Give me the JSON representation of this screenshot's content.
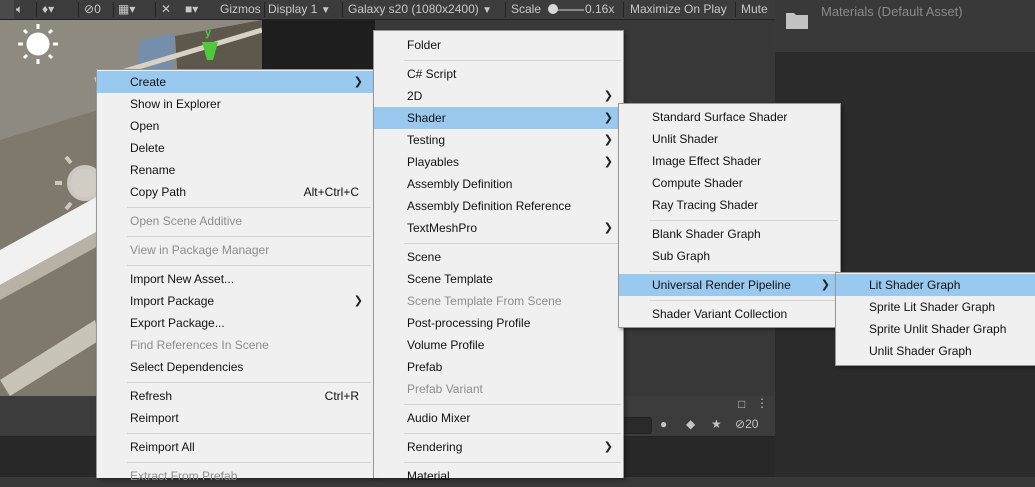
{
  "toolbar": {
    "hidden_count": "0",
    "gizmos": "Gizmos",
    "display": "Display 1",
    "device": "Galaxy s20 (1080x2400)",
    "scale_label": "Scale",
    "scale_value": "0.16x",
    "maximize": "Maximize On Play",
    "mute": "Mute"
  },
  "project": {
    "asset_label": "Materials (Default Asset)"
  },
  "console": {
    "visibility_count": "20"
  },
  "menu1": {
    "items": [
      {
        "label": "Create",
        "shortcut": ""
      },
      {
        "label": "Show in Explorer",
        "shortcut": ""
      },
      {
        "label": "Open",
        "shortcut": ""
      },
      {
        "label": "Delete",
        "shortcut": ""
      },
      {
        "label": "Rename",
        "shortcut": ""
      },
      {
        "label": "Copy Path",
        "shortcut": "Alt+Ctrl+C"
      },
      {
        "label": "Open Scene Additive",
        "shortcut": ""
      },
      {
        "label": "View in Package Manager",
        "shortcut": ""
      },
      {
        "label": "Import New Asset...",
        "shortcut": ""
      },
      {
        "label": "Import Package",
        "shortcut": ""
      },
      {
        "label": "Export Package...",
        "shortcut": ""
      },
      {
        "label": "Find References In Scene",
        "shortcut": ""
      },
      {
        "label": "Select Dependencies",
        "shortcut": ""
      },
      {
        "label": "Refresh",
        "shortcut": "Ctrl+R"
      },
      {
        "label": "Reimport",
        "shortcut": ""
      },
      {
        "label": "Reimport All",
        "shortcut": ""
      },
      {
        "label": "Extract From Prefab",
        "shortcut": ""
      }
    ]
  },
  "menu2": {
    "items": [
      {
        "label": "Folder"
      },
      {
        "label": "C# Script"
      },
      {
        "label": "2D"
      },
      {
        "label": "Shader"
      },
      {
        "label": "Testing"
      },
      {
        "label": "Playables"
      },
      {
        "label": "Assembly Definition"
      },
      {
        "label": "Assembly Definition Reference"
      },
      {
        "label": "TextMeshPro"
      },
      {
        "label": "Scene"
      },
      {
        "label": "Scene Template"
      },
      {
        "label": "Scene Template From Scene"
      },
      {
        "label": "Post-processing Profile"
      },
      {
        "label": "Volume Profile"
      },
      {
        "label": "Prefab"
      },
      {
        "label": "Prefab Variant"
      },
      {
        "label": "Audio Mixer"
      },
      {
        "label": "Rendering"
      },
      {
        "label": "Material"
      }
    ]
  },
  "menu3": {
    "items": [
      {
        "label": "Standard Surface Shader"
      },
      {
        "label": "Unlit Shader"
      },
      {
        "label": "Image Effect Shader"
      },
      {
        "label": "Compute Shader"
      },
      {
        "label": "Ray Tracing Shader"
      },
      {
        "label": "Blank Shader Graph"
      },
      {
        "label": "Sub Graph"
      },
      {
        "label": "Universal Render Pipeline"
      },
      {
        "label": "Shader Variant Collection"
      }
    ]
  },
  "menu4": {
    "items": [
      {
        "label": "Lit Shader Graph"
      },
      {
        "label": "Sprite Lit Shader Graph"
      },
      {
        "label": "Sprite Unlit Shader Graph"
      },
      {
        "label": "Unlit Shader Graph"
      }
    ]
  },
  "colors": {
    "highlight": "#99c9ef",
    "menu_bg": "#f0f0f0",
    "disabled": "#8d8d8d"
  }
}
